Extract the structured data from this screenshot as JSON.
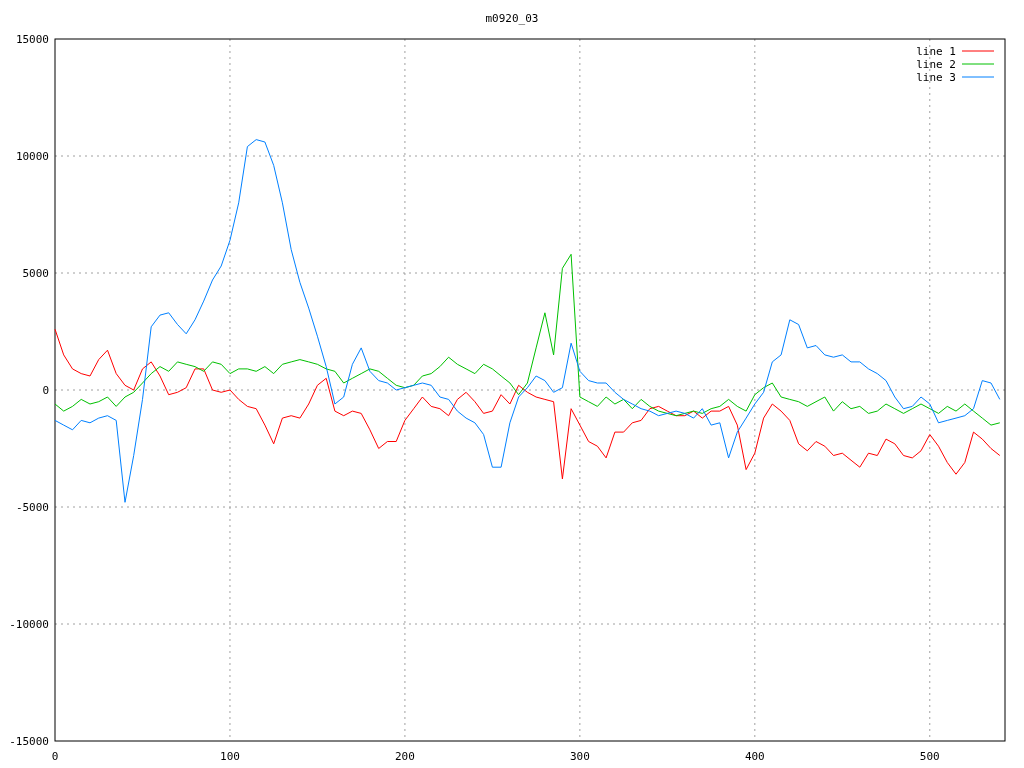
{
  "plot": {
    "chart_data": {
      "type": "line",
      "title": "m0920_03",
      "x": [
        0,
        5,
        10,
        15,
        20,
        25,
        30,
        35,
        40,
        45,
        50,
        55,
        60,
        65,
        70,
        75,
        80,
        85,
        90,
        95,
        100,
        105,
        110,
        115,
        120,
        125,
        130,
        135,
        140,
        145,
        150,
        155,
        160,
        165,
        170,
        175,
        180,
        185,
        190,
        195,
        200,
        205,
        210,
        215,
        220,
        225,
        230,
        235,
        240,
        245,
        250,
        255,
        260,
        265,
        270,
        275,
        280,
        285,
        290,
        295,
        300,
        305,
        310,
        315,
        320,
        325,
        330,
        335,
        340,
        345,
        350,
        355,
        360,
        365,
        370,
        375,
        380,
        385,
        390,
        395,
        400,
        405,
        410,
        415,
        420,
        425,
        430,
        435,
        440,
        445,
        450,
        455,
        460,
        465,
        470,
        475,
        480,
        485,
        490,
        495,
        500,
        505,
        510,
        515,
        520,
        525,
        530,
        535,
        540
      ],
      "xlim": [
        0,
        543
      ],
      "ylim": [
        -15000,
        15000
      ],
      "grid": true,
      "legend": true,
      "xticks": [
        0,
        100,
        200,
        300,
        400,
        500
      ],
      "yticks": [
        -15000,
        -10000,
        -5000,
        0,
        5000,
        10000,
        15000
      ],
      "series": [
        {
          "name": "line 1",
          "color": "#ff0000",
          "values": [
            2600,
            1500,
            900,
            700,
            600,
            1300,
            1700,
            700,
            200,
            0,
            900,
            1200,
            600,
            -200,
            -100,
            100,
            900,
            900,
            0,
            -100,
            0,
            -400,
            -700,
            -800,
            -1500,
            -2300,
            -1200,
            -1100,
            -1200,
            -600,
            200,
            500,
            -900,
            -1100,
            -900,
            -1000,
            -1700,
            -2500,
            -2200,
            -2200,
            -1300,
            -800,
            -300,
            -700,
            -800,
            -1100,
            -400,
            -100,
            -500,
            -1000,
            -900,
            -200,
            -600,
            200,
            -100,
            -300,
            -400,
            -500,
            -3800,
            -800,
            -1500,
            -2200,
            -2400,
            -2900,
            -1800,
            -1800,
            -1400,
            -1300,
            -800,
            -700,
            -900,
            -1100,
            -1100,
            -900,
            -1200,
            -900,
            -900,
            -700,
            -1500,
            -3400,
            -2700,
            -1200,
            -600,
            -900,
            -1300,
            -2300,
            -2600,
            -2200,
            -2400,
            -2800,
            -2700,
            -3000,
            -3300,
            -2700,
            -2800,
            -2100,
            -2300,
            -2800,
            -2900,
            -2600,
            -1900,
            -2400,
            -3100,
            -3600,
            -3100,
            -1800,
            -2100,
            -2500,
            -2800
          ]
        },
        {
          "name": "line 2",
          "color": "#00c000",
          "values": [
            -600,
            -900,
            -700,
            -400,
            -600,
            -500,
            -300,
            -700,
            -300,
            -100,
            300,
            700,
            1000,
            800,
            1200,
            1100,
            1000,
            800,
            1200,
            1100,
            700,
            900,
            900,
            800,
            1000,
            700,
            1100,
            1200,
            1300,
            1200,
            1100,
            900,
            800,
            300,
            500,
            700,
            900,
            800,
            500,
            200,
            100,
            200,
            600,
            700,
            1000,
            1400,
            1100,
            900,
            700,
            1100,
            900,
            600,
            300,
            -200,
            300,
            1800,
            3300,
            1500,
            5200,
            5800,
            -300,
            -500,
            -700,
            -300,
            -600,
            -400,
            -800,
            -400,
            -700,
            -900,
            -1000,
            -1100,
            -1000,
            -900,
            -1000,
            -800,
            -700,
            -400,
            -700,
            -900,
            -200,
            100,
            300,
            -300,
            -400,
            -500,
            -700,
            -500,
            -300,
            -900,
            -500,
            -800,
            -700,
            -1000,
            -900,
            -600,
            -800,
            -1000,
            -800,
            -600,
            -800,
            -1000,
            -700,
            -900,
            -600,
            -900,
            -1200,
            -1500,
            -1400
          ]
        },
        {
          "name": "line 3",
          "color": "#0080ff",
          "values": [
            -1300,
            -1500,
            -1700,
            -1300,
            -1400,
            -1200,
            -1100,
            -1300,
            -4800,
            -2800,
            -400,
            2700,
            3200,
            3300,
            2800,
            2400,
            3000,
            3800,
            4700,
            5300,
            6400,
            8000,
            10400,
            10700,
            10600,
            9600,
            8000,
            6000,
            4600,
            3500,
            2300,
            1000,
            -600,
            -300,
            1100,
            1800,
            800,
            400,
            300,
            0,
            100,
            200,
            300,
            200,
            -300,
            -400,
            -900,
            -1200,
            -1400,
            -1900,
            -3300,
            -3300,
            -1400,
            -300,
            100,
            600,
            400,
            -100,
            100,
            2000,
            800,
            400,
            300,
            300,
            -100,
            -400,
            -600,
            -800,
            -900,
            -1100,
            -1000,
            -900,
            -1000,
            -1200,
            -800,
            -1500,
            -1400,
            -2900,
            -1800,
            -1200,
            -600,
            -100,
            1200,
            1500,
            3000,
            2800,
            1800,
            1900,
            1500,
            1400,
            1500,
            1200,
            1200,
            900,
            700,
            400,
            -300,
            -800,
            -700,
            -300,
            -600,
            -1400,
            -1300,
            -1200,
            -1100,
            -800,
            400,
            300,
            -400
          ]
        }
      ]
    }
  }
}
